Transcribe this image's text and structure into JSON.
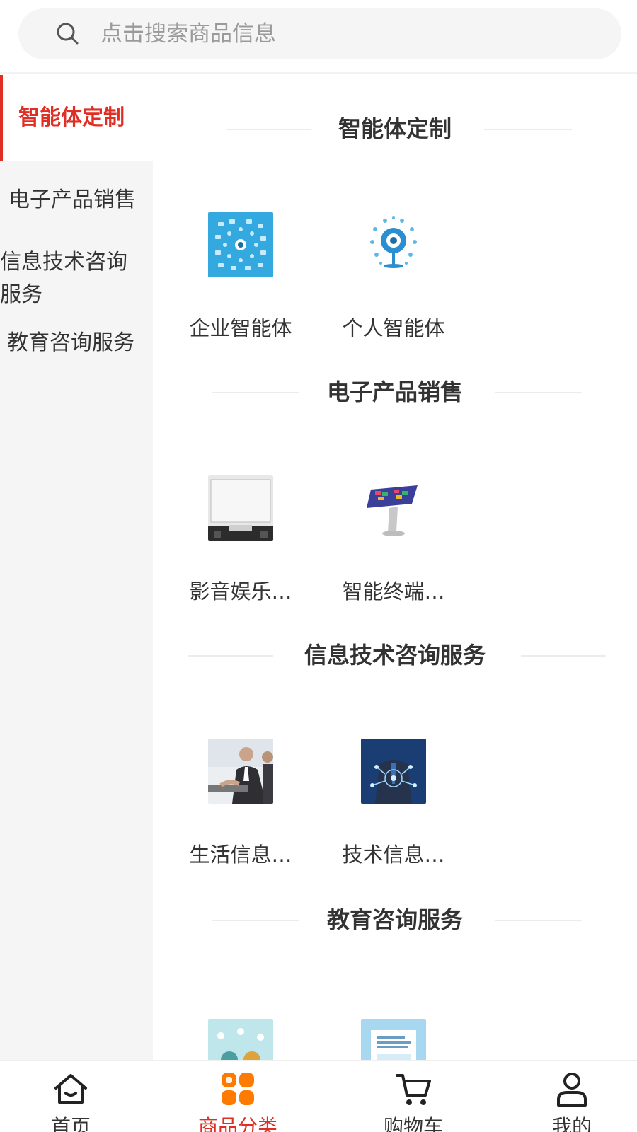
{
  "search": {
    "placeholder": "点击搜索商品信息",
    "icon": "search-icon"
  },
  "sidebar": {
    "items": [
      {
        "label": "智能体定制",
        "active": true
      },
      {
        "label": "电子产品销售",
        "active": false
      },
      {
        "label": "信息技术咨询服务",
        "active": false
      },
      {
        "label": "教育咨询服务",
        "active": false
      }
    ]
  },
  "sections": [
    {
      "title": "智能体定制",
      "items": [
        {
          "name": "企业智能体"
        },
        {
          "name": "个人智能体"
        }
      ]
    },
    {
      "title": "电子产品销售",
      "items": [
        {
          "name": "影音娱乐…"
        },
        {
          "name": "智能终端…"
        }
      ]
    },
    {
      "title": "信息技术咨询服务",
      "items": [
        {
          "name": "生活信息…"
        },
        {
          "name": "技术信息…"
        }
      ]
    },
    {
      "title": "教育咨询服务",
      "items": [
        {
          "name": ""
        },
        {
          "name": ""
        }
      ]
    }
  ],
  "tabbar": {
    "items": [
      {
        "label": "首页",
        "icon": "home-icon",
        "active": false
      },
      {
        "label": "商品分类",
        "icon": "category-icon",
        "active": true
      },
      {
        "label": "购物车",
        "icon": "cart-icon",
        "active": false
      },
      {
        "label": "我的",
        "icon": "user-icon",
        "active": false
      }
    ]
  },
  "colors": {
    "accent": "#e02e24",
    "category_icon": "#ff7a00",
    "sidebar_bg": "#f5f5f5"
  }
}
